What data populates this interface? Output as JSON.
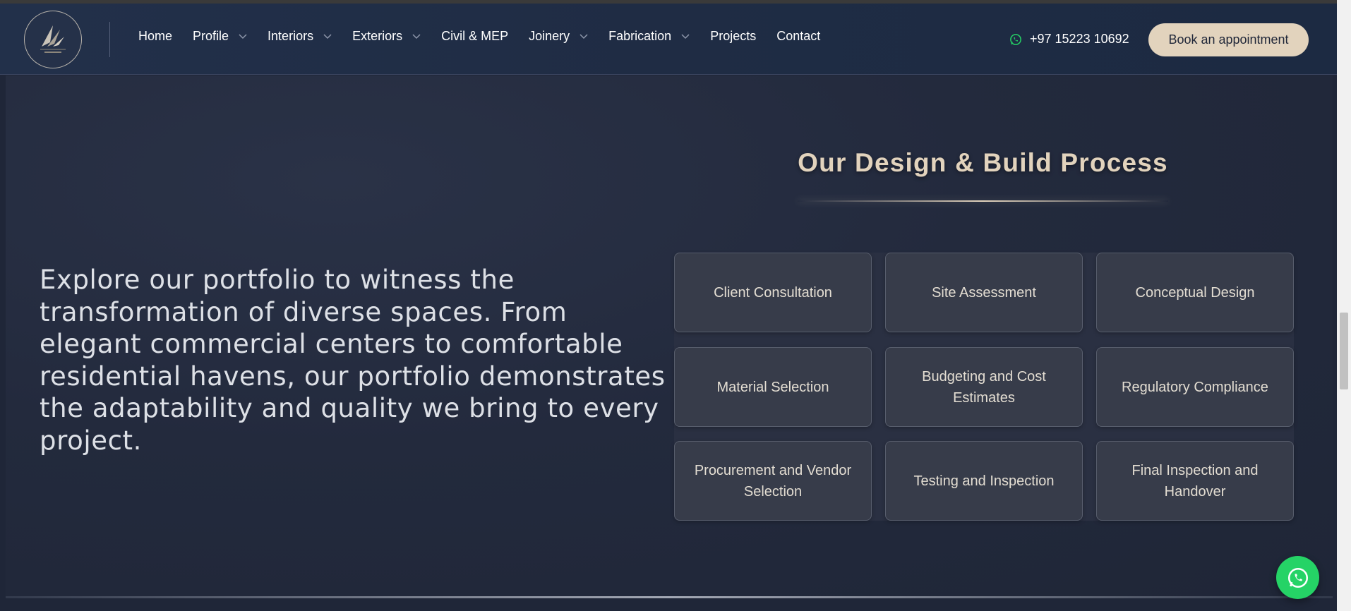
{
  "header": {
    "nav": [
      {
        "label": "Home",
        "dropdown": false
      },
      {
        "label": "Profile",
        "dropdown": true
      },
      {
        "label": "Interiors",
        "dropdown": true
      },
      {
        "label": "Exteriors",
        "dropdown": true
      },
      {
        "label": "Civil & MEP",
        "dropdown": false
      },
      {
        "label": "Joinery",
        "dropdown": true
      },
      {
        "label": "Fabrication",
        "dropdown": true
      },
      {
        "label": "Projects",
        "dropdown": false
      },
      {
        "label": "Contact",
        "dropdown": false
      }
    ],
    "phone": "+97 15223 10692",
    "cta": "Book an appointment"
  },
  "main": {
    "intro": "Explore our portfolio to witness the transformation of diverse spaces. From elegant commercial centers to comfortable residential havens, our portfolio demonstrates the adaptability and quality we bring to every project.",
    "process_title": "Our Design & Build Process",
    "steps": [
      "Client Consultation",
      "Site Assessment",
      "Conceptual Design",
      "Material Selection",
      "Budgeting and Cost Estimates",
      "Regulatory Compliance",
      "Procurement and Vendor Selection",
      "Testing and Inspection",
      "Final Inspection and Handover"
    ]
  },
  "colors": {
    "background": "#1f2638",
    "accent": "#e2d3bd",
    "whatsapp": "#25d366"
  },
  "icons": {
    "logo": "logo-emblem",
    "dropdown": "chevron-down-icon",
    "phone": "whatsapp-icon",
    "floating": "whatsapp-icon"
  }
}
